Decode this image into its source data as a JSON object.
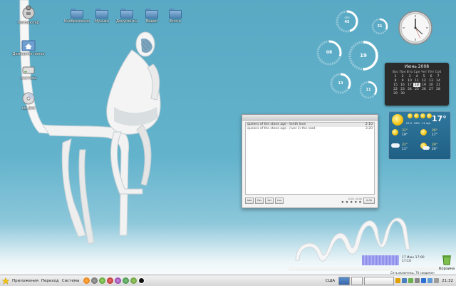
{
  "desktop_icons": [
    {
      "label": "Компьютер",
      "icon": "computer-icon"
    },
    {
      "label": "Домашняя папка",
      "icon": "home-folder-icon"
    },
    {
      "label": "Система",
      "icon": "drive-icon"
    },
    {
      "label": "ub_dvd",
      "icon": "cd-icon"
    }
  ],
  "top_folders": [
    {
      "label": "Изображения"
    },
    {
      "label": "Музыка"
    },
    {
      "label": "Документы"
    },
    {
      "label": "Видео"
    },
    {
      "label": "Блоги"
    }
  ],
  "meters": [
    {
      "value": "45",
      "caption": "CPU"
    },
    {
      "value": "31",
      "caption": ""
    },
    {
      "value": "08",
      "caption": ""
    },
    {
      "value": "19",
      "caption": ""
    },
    {
      "value": "13",
      "caption": ""
    },
    {
      "value": "11",
      "caption": ""
    }
  ],
  "calendar": {
    "title": "Июнь 2008",
    "weekdays": [
      "Вос",
      "Пон",
      "Вто",
      "Сре",
      "Чет",
      "Пят",
      "Суб"
    ],
    "weeks": [
      [
        "1",
        "2",
        "3",
        "4",
        "5",
        "6",
        "7"
      ],
      [
        "8",
        "9",
        "10",
        "11",
        "12",
        "13",
        "14"
      ],
      [
        "15",
        "16",
        "17",
        "18",
        "19",
        "20",
        "21"
      ],
      [
        "22",
        "23",
        "24",
        "25",
        "26",
        "27",
        "28"
      ],
      [
        "29",
        "30",
        "",
        "",
        "",
        "",
        ""
      ]
    ],
    "today": "18"
  },
  "weather": {
    "temp": "17°",
    "detail": "97.0 · 59% · 11 m/s",
    "days": [
      {
        "hi": "31°",
        "lo": "19°"
      },
      {
        "hi": "26°",
        "lo": "17°"
      },
      {
        "hi": "31°",
        "lo": "11°"
      },
      {
        "hi": "29°",
        "lo": "20°"
      }
    ]
  },
  "player": {
    "tracks": [
      {
        "title": "queens of the stone age - tenth love",
        "time": "2:10"
      },
      {
        "title": "queens of the stone age - river in the road",
        "time": "3:20"
      }
    ],
    "buttons": [
      "Add",
      "Del",
      "Sel",
      "List"
    ],
    "time": "0:00 / 0:00",
    "counter": "0:00"
  },
  "trash": {
    "label": "Корзина"
  },
  "tray": {
    "readout": [
      "17 Июн 17:00",
      "17:10"
    ],
    "note": "Сеть включены, 70 соединен"
  },
  "panel": {
    "menus": [
      "Приложения",
      "Переход",
      "Система"
    ],
    "keyboard": "США",
    "clock": "21:32"
  }
}
